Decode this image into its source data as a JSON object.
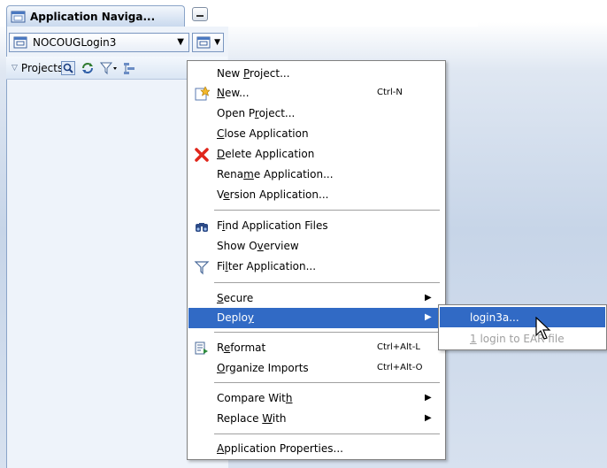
{
  "navigator": {
    "title": "Application Naviga...",
    "application": "NOCOUGLogin3",
    "projects_label": "Projects"
  },
  "context_menu": {
    "items": [
      {
        "label": "New Project...",
        "accel": "",
        "submenu": false,
        "icon": ""
      },
      {
        "label": "New...",
        "accel": "Ctrl-N",
        "submenu": false,
        "icon": "new-gallery-icon"
      },
      {
        "label": "Open Project...",
        "accel": "",
        "submenu": false,
        "icon": ""
      },
      {
        "label": "Close Application",
        "accel": "",
        "submenu": false,
        "icon": ""
      },
      {
        "label": "Delete Application",
        "accel": "",
        "submenu": false,
        "icon": "red-x-icon"
      },
      {
        "label": "Rename Application...",
        "accel": "",
        "submenu": false,
        "icon": ""
      },
      {
        "label": "Version Application...",
        "accel": "",
        "submenu": false,
        "icon": ""
      },
      {
        "label": "Find Application Files",
        "accel": "",
        "submenu": false,
        "icon": "binoculars-icon"
      },
      {
        "label": "Show Overview",
        "accel": "",
        "submenu": false,
        "icon": ""
      },
      {
        "label": "Filter Application...",
        "accel": "",
        "submenu": false,
        "icon": "funnel-icon"
      },
      {
        "label": "Secure",
        "accel": "",
        "submenu": true,
        "icon": ""
      },
      {
        "label": "Deploy",
        "accel": "",
        "submenu": true,
        "icon": "",
        "selected": true
      },
      {
        "label": "Reformat",
        "accel": "Ctrl+Alt-L",
        "submenu": false,
        "icon": "reformat-icon"
      },
      {
        "label": "Organize Imports",
        "accel": "Ctrl+Alt-O",
        "submenu": false,
        "icon": ""
      },
      {
        "label": "Compare With",
        "accel": "",
        "submenu": true,
        "icon": ""
      },
      {
        "label": "Replace With",
        "accel": "",
        "submenu": true,
        "icon": ""
      },
      {
        "label": "Application Properties...",
        "accel": "",
        "submenu": false,
        "icon": ""
      }
    ]
  },
  "deploy_submenu": {
    "items": [
      {
        "label": "login3a...",
        "enabled": true,
        "selected": true
      },
      {
        "label": "1 login to EAR file",
        "enabled": false,
        "selected": false
      }
    ]
  },
  "colors": {
    "selection": "#316ac5",
    "disabled_text": "#a0a0a0"
  }
}
